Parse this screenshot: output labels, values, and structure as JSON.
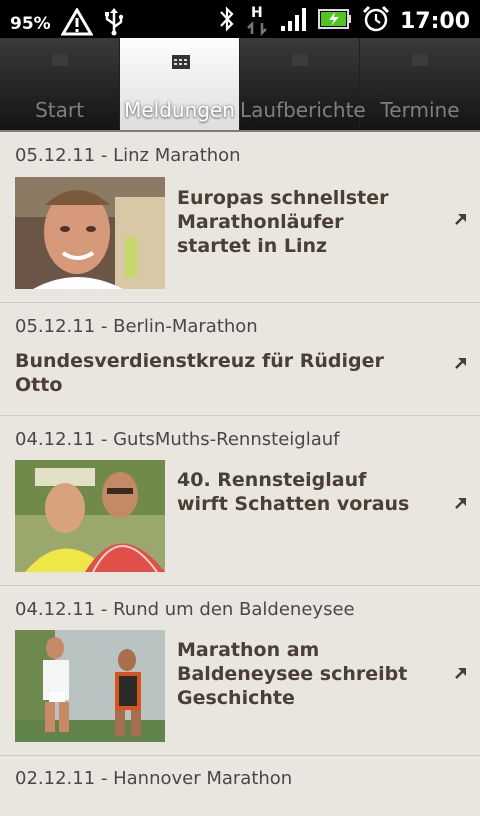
{
  "status": {
    "battery_pct": "95%",
    "time": "17:00",
    "net_label": "H"
  },
  "tabs": [
    {
      "label": "Start",
      "active": false
    },
    {
      "label": "Meldungen",
      "active": true
    },
    {
      "label": "Laufberichte",
      "active": false
    },
    {
      "label": "Termine",
      "active": false
    }
  ],
  "news": [
    {
      "date": "05.12.11 - Linz Marathon",
      "title": "Europas schnellster Marathonläufer startet in Linz",
      "has_image": true
    },
    {
      "date": "05.12.11 - Berlin-Marathon",
      "title": "Bundesverdienstkreuz für Rüdiger Otto",
      "has_image": false
    },
    {
      "date": "04.12.11 - GutsMuths-Rennsteiglauf",
      "title": "40. Rennsteiglauf wirft Schatten voraus",
      "has_image": true
    },
    {
      "date": "04.12.11 - Rund um den Baldeneysee",
      "title": "Marathon am Baldeneysee schreibt Geschichte",
      "has_image": true
    },
    {
      "date": "02.12.11 - Hannover Marathon",
      "title": "",
      "has_image": false
    }
  ],
  "colors": {
    "background": "#e9e5df",
    "title_text": "#4a3e35",
    "date_text": "#4c4745",
    "battery_green": "#4fc51f"
  }
}
